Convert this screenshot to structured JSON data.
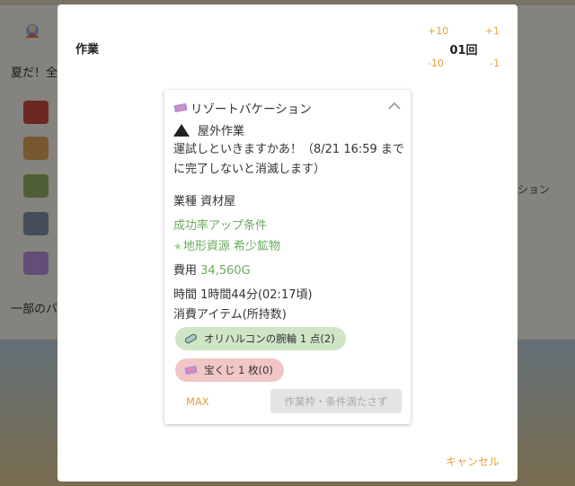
{
  "background": {
    "text_left_top": "夏だ！全",
    "text_left_bottom": "一部のバ",
    "text_right": "ション"
  },
  "modal": {
    "title": "作業",
    "stepper": {
      "plus10": "+10",
      "plus1": "+1",
      "count": "01回",
      "minus10": "-10",
      "minus1": "-1"
    },
    "card": {
      "title": "リゾートバケーション",
      "title_icon": "ticket-icon",
      "location": "屋外作業",
      "location_icon": "mountain-icon",
      "description": "運試しといきますかあ！（8/21 16:59 までに完了しないと消滅します）",
      "industry": "業種 資材屋",
      "success_heading": "成功率アップ条件",
      "success_condition": "地形資源 希少鉱物",
      "cost_label": "費用",
      "cost_value": "34,560G",
      "time": "時間 1時間44分(02:17頃)",
      "consumables_heading": "消費アイテム(所持数)",
      "items": [
        {
          "label": "オリハルコンの腕輪 1 点(2)",
          "icon": "bracelet-icon",
          "color": "#cfe6c6"
        },
        {
          "label": "宝くじ 1 枚(0)",
          "icon": "ticket-icon",
          "color": "#f2c6c6"
        }
      ],
      "max_label": "MAX",
      "submit_label": "作業枠・条件満たさず"
    },
    "cancel_label": "キャンセル"
  },
  "colors": {
    "accent": "#e5a13a",
    "success_green": "#6aab5c",
    "disabled_bg": "#e4e4e4"
  }
}
